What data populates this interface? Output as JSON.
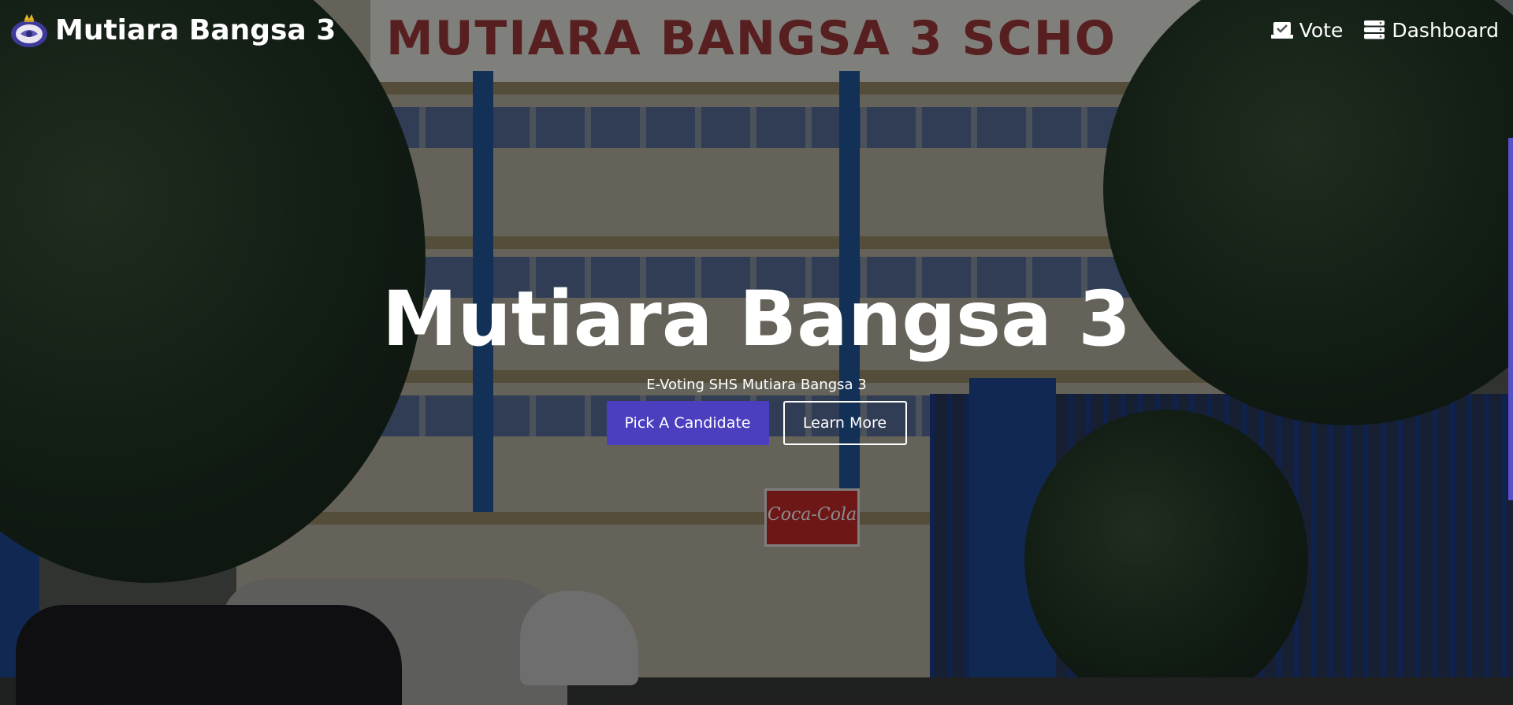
{
  "navbar": {
    "brand": "Mutiara Bangsa 3",
    "logo_icon": "school-crest-icon",
    "links": [
      {
        "label": "Vote",
        "icon": "vote-ballot-icon"
      },
      {
        "label": "Dashboard",
        "icon": "server-dashboard-icon"
      }
    ]
  },
  "background": {
    "building_sign": "MUTIARA BANGSA 3 SCHO",
    "coke_sign": "Coca-Cola"
  },
  "hero": {
    "title": "Mutiara Bangsa 3",
    "subtitle": "E-Voting SHS Mutiara Bangsa 3",
    "primary_button": "Pick A Candidate",
    "secondary_button": "Learn More"
  },
  "colors": {
    "accent": "#4b3fbf",
    "text": "#ffffff",
    "overlay": "rgba(0,0,0,0.45)"
  }
}
